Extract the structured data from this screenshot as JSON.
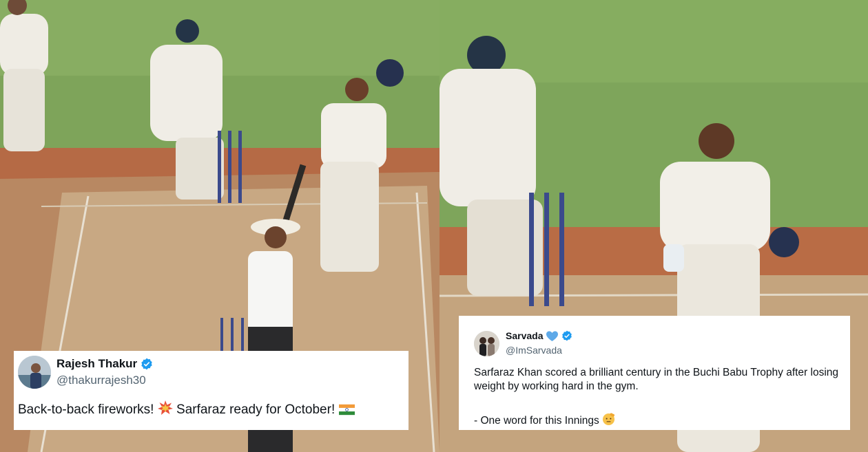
{
  "image": {
    "left_panel": {
      "scene": "cricket-batter-raising-helmet"
    },
    "right_panel": {
      "scene": "cricket-batter-smiling"
    }
  },
  "tweets": [
    {
      "display_name": "Rajesh Thakur",
      "handle": "@thakurrajesh30",
      "text_before": "Back-to-back fireworks!",
      "text_after": "Sarfaraz ready for October!",
      "icons": [
        "collision-emoji-icon",
        "india-flag-icon"
      ],
      "verified_color": "#1d9bf0"
    },
    {
      "display_name": "Sarvada",
      "handle": "@ImSarvada",
      "text": "Sarfaraz Khan scored a brilliant century in the Buchi Babu Trophy after losing weight by working hard in the gym.",
      "text2": "- One word for this Innings",
      "icons": [
        "blue-heart-icon",
        "saluting-face-icon"
      ],
      "verified_color": "#1d9bf0",
      "heart_color": "#5ea9e8"
    }
  ]
}
